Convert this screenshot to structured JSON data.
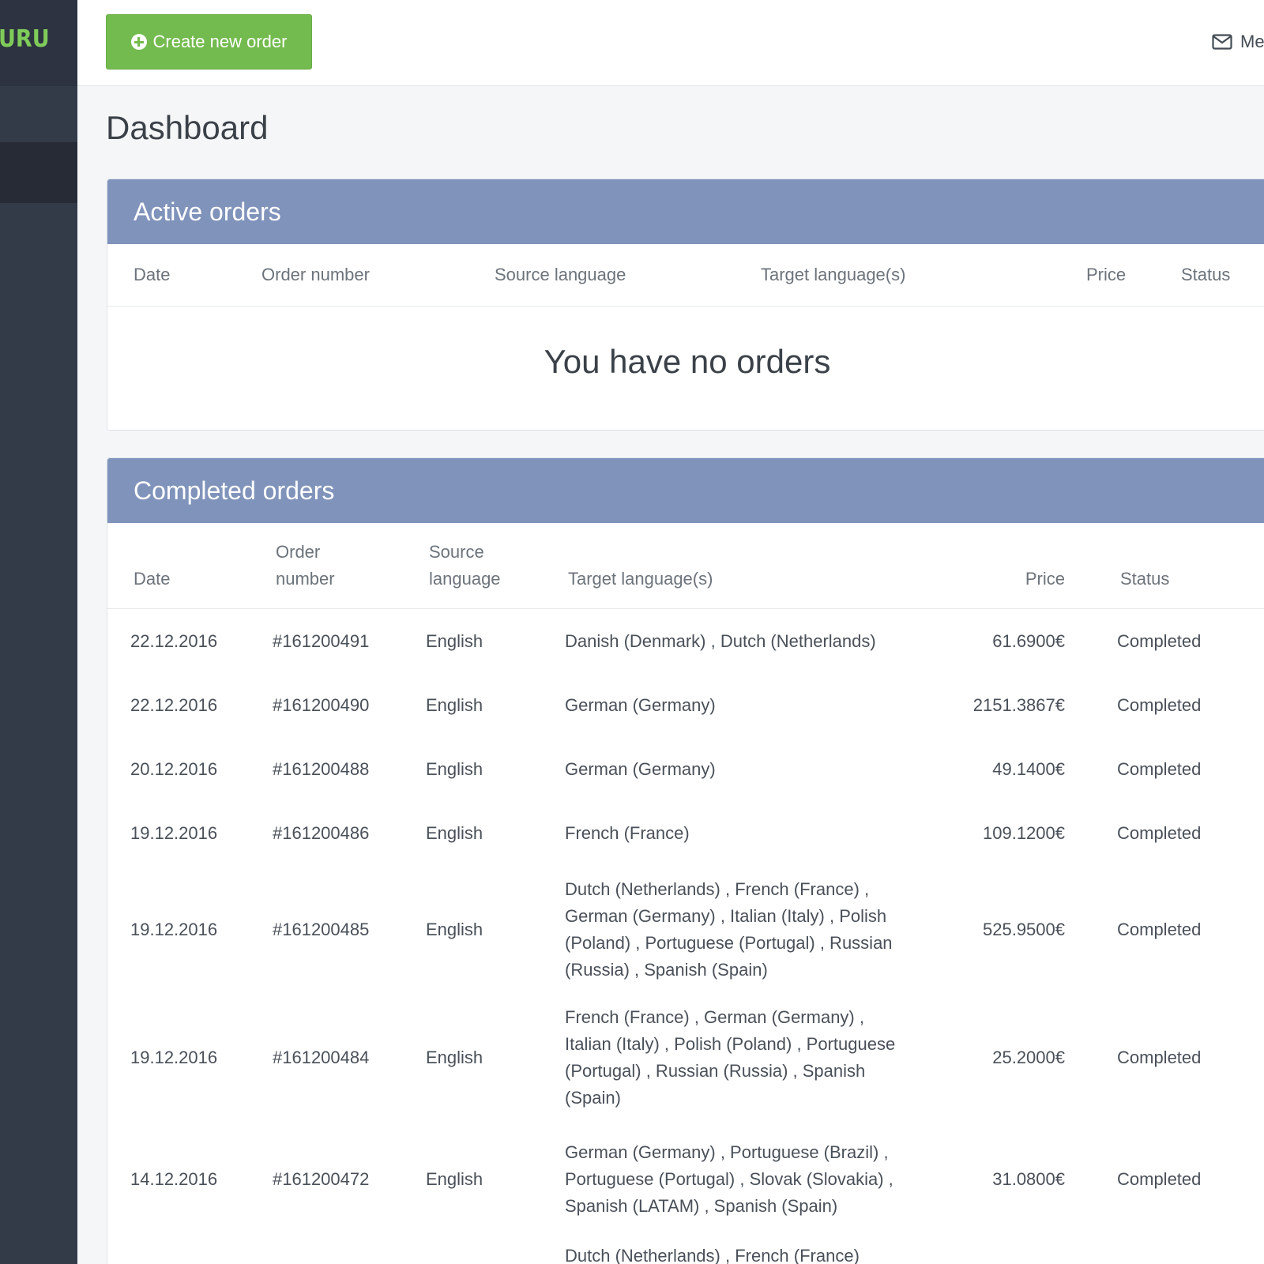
{
  "sidebar": {
    "logo_text": "URU"
  },
  "topbar": {
    "create_button_label": "Create new order",
    "messages_label": "Messages"
  },
  "page_title": "Dashboard",
  "active_orders": {
    "title": "Active orders",
    "columns": [
      "Date",
      "Order number",
      "Source language",
      "Target language(s)",
      "Price",
      "Status"
    ],
    "empty_message": "You have no orders"
  },
  "completed_orders": {
    "title": "Completed orders",
    "columns": [
      "Date",
      "Order number",
      "Source language",
      "Target language(s)",
      "Price",
      "Status"
    ],
    "rows": [
      {
        "date": "22.12.2016",
        "order": "#161200491",
        "source": "English",
        "target": "Danish (Denmark) , Dutch (Netherlands)",
        "price": "61.6900€",
        "status": "Completed"
      },
      {
        "date": "22.12.2016",
        "order": "#161200490",
        "source": "English",
        "target": "German (Germany)",
        "price": "2151.3867€",
        "status": "Completed"
      },
      {
        "date": "20.12.2016",
        "order": "#161200488",
        "source": "English",
        "target": "German (Germany)",
        "price": "49.1400€",
        "status": "Completed"
      },
      {
        "date": "19.12.2016",
        "order": "#161200486",
        "source": "English",
        "target": "French (France)",
        "price": "109.1200€",
        "status": "Completed"
      },
      {
        "date": "19.12.2016",
        "order": "#161200485",
        "source": "English",
        "target": "Dutch (Netherlands) , French (France) , German (Germany) , Italian (Italy) , Polish (Poland) , Portuguese (Portugal) , Russian (Russia) , Spanish (Spain)",
        "price": "525.9500€",
        "status": "Completed"
      },
      {
        "date": "19.12.2016",
        "order": "#161200484",
        "source": "English",
        "target": "French (France) , German (Germany) , Italian (Italy) , Polish (Poland) , Portuguese (Portugal) , Russian (Russia) , Spanish (Spain)",
        "price": "25.2000€",
        "status": "Completed"
      },
      {
        "date": "14.12.2016",
        "order": "#161200472",
        "source": "English",
        "target": "German (Germany) , Portuguese (Brazil) , Portuguese (Portugal) , Slovak (Slovakia) , Spanish (LATAM) , Spanish (Spain)",
        "price": "31.0800€",
        "status": "Completed"
      },
      {
        "date": "",
        "order": "",
        "source": "",
        "target": "Dutch (Netherlands) , French (France)",
        "price": "",
        "status": ""
      }
    ]
  }
}
